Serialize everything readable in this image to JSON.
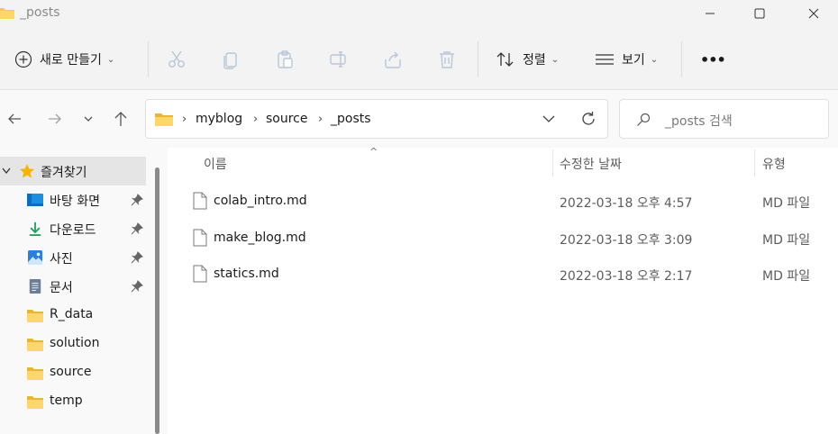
{
  "title": "_posts",
  "commands": {
    "new": "새로 만들기",
    "sort": "정렬",
    "view": "보기",
    "more": "•••"
  },
  "address": {
    "crumbs": [
      "myblog",
      "source",
      "_posts"
    ],
    "search_placeholder": "_posts 검색"
  },
  "sidebar": {
    "quick_access": "즐겨찾기",
    "items": [
      {
        "label": "바탕 화면",
        "icon": "desktop-icon",
        "pinned": true
      },
      {
        "label": "다운로드",
        "icon": "download-icon",
        "pinned": true
      },
      {
        "label": "사진",
        "icon": "pictures-icon",
        "pinned": true
      },
      {
        "label": "문서",
        "icon": "documents-icon",
        "pinned": true
      },
      {
        "label": "R_data",
        "icon": "folder-icon",
        "pinned": false
      },
      {
        "label": "solution",
        "icon": "folder-icon",
        "pinned": false
      },
      {
        "label": "source",
        "icon": "folder-icon",
        "pinned": false
      },
      {
        "label": "temp",
        "icon": "folder-icon",
        "pinned": false
      }
    ]
  },
  "columns": {
    "name": "이름",
    "modified": "수정한 날짜",
    "type": "유형"
  },
  "files": [
    {
      "name": "colab_intro.md",
      "modified": "2022-03-18 오후 4:57",
      "type": "MD 파일"
    },
    {
      "name": "make_blog.md",
      "modified": "2022-03-18 오후 3:09",
      "type": "MD 파일"
    },
    {
      "name": "statics.md",
      "modified": "2022-03-18 오후 2:17",
      "type": "MD 파일"
    }
  ],
  "colors": {
    "folder": "#f7c948",
    "accent": "#0067c0",
    "star": "#f5b400"
  }
}
